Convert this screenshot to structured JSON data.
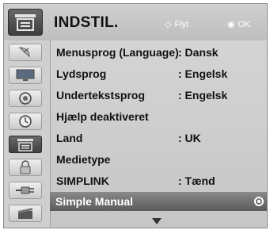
{
  "header": {
    "title": "INDSTIL.",
    "hint_move_glyph": "◇",
    "hint_move_label": "Flyt",
    "hint_ok_glyph": "◉",
    "hint_ok_label": "OK"
  },
  "sidebar": {
    "icons": [
      "satellite-dish-icon",
      "picture-icon",
      "audio-icon",
      "clock-icon",
      "settings-icon",
      "lock-icon",
      "simplink-plug-icon",
      "movie-icon"
    ],
    "active_index": 4
  },
  "menu": {
    "items": [
      {
        "label": "Menusprog (Language)",
        "value": ": Dansk"
      },
      {
        "label": "Lydsprog",
        "value": ": Engelsk"
      },
      {
        "label": "Undertekstsprog",
        "value": ": Engelsk"
      },
      {
        "label": "Hjælp deaktiveret",
        "value": ""
      },
      {
        "label": "Land",
        "value": ": UK"
      },
      {
        "label": "Medietype",
        "value": ""
      },
      {
        "label": "SIMPLINK",
        "value": ": Tænd"
      },
      {
        "label": "Simple Manual",
        "value": ""
      }
    ],
    "selected_index": 7
  },
  "colors": {
    "panel_bg": "#c8c8c8",
    "selected_bg": "#6e6e6e",
    "hint_text": "#ffffff"
  }
}
